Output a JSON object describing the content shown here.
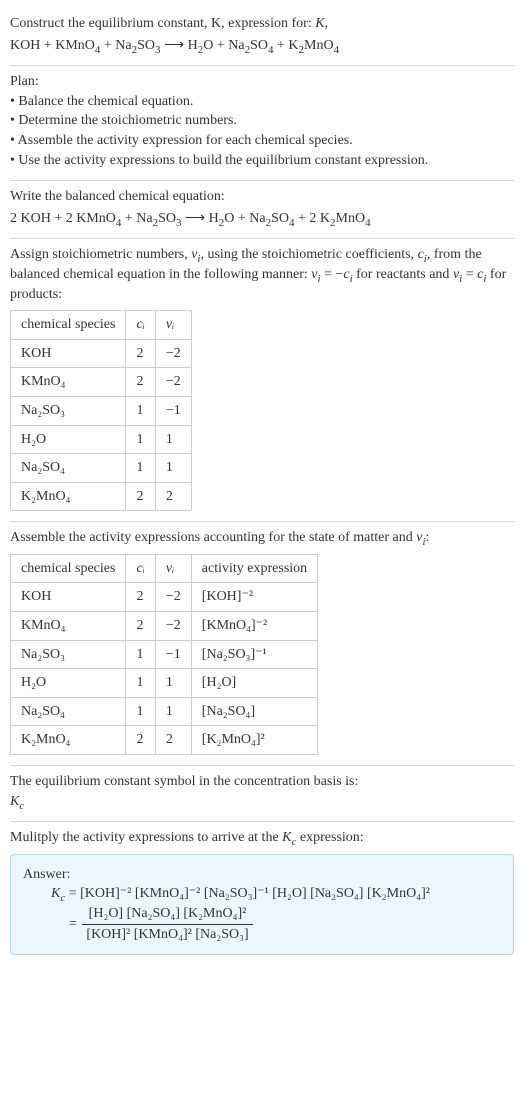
{
  "intro": {
    "line1": "Construct the equilibrium constant, K, expression for:",
    "eq_lhs": "KOH + KMnO",
    "eq_mid1": " + Na",
    "eq_mid2": "SO",
    "eq_arrow": " ⟶ H",
    "eq_mid3": "O + Na",
    "eq_mid4": "SO",
    "eq_mid5": " + K",
    "eq_mid6": "MnO"
  },
  "plan": {
    "head": "Plan:",
    "item1": "• Balance the chemical equation.",
    "item2": "• Determine the stoichiometric numbers.",
    "item3": "• Assemble the activity expression for each chemical species.",
    "item4": "• Use the activity expressions to build the equilibrium constant expression."
  },
  "balanced": {
    "head": "Write the balanced chemical equation:",
    "pre1": "2 KOH + 2 KMnO",
    "pre2": " + Na",
    "pre3": "SO",
    "arrow": " ⟶ H",
    "post1": "O + Na",
    "post2": "SO",
    "post3": " + 2 K",
    "post4": "MnO"
  },
  "stoich_text": {
    "line1_a": "Assign stoichiometric numbers, ",
    "line1_b": ", using the stoichiometric coefficients, ",
    "line1_c": ", from the balanced chemical equation in the following manner: ",
    "line1_d": " for reactants and ",
    "line1_e": " for products:",
    "nu": "ν",
    "c": "c",
    "sub": "i",
    "eq1": " = −",
    "eq2": " = "
  },
  "table1": {
    "h1": "chemical species",
    "h2": "cᵢ",
    "h3": "νᵢ",
    "rows": [
      {
        "sp": "KOH",
        "c": "2",
        "v": "−2"
      },
      {
        "sp": "KMnO₄",
        "c": "2",
        "v": "−2"
      },
      {
        "sp": "Na₂SO₃",
        "c": "1",
        "v": "−1"
      },
      {
        "sp": "H₂O",
        "c": "1",
        "v": "1"
      },
      {
        "sp": "Na₂SO₄",
        "c": "1",
        "v": "1"
      },
      {
        "sp": "K₂MnO₄",
        "c": "2",
        "v": "2"
      }
    ]
  },
  "assemble_text": {
    "a": "Assemble the activity expressions accounting for the state of matter and ",
    "b": ":"
  },
  "table2": {
    "h1": "chemical species",
    "h2": "cᵢ",
    "h3": "νᵢ",
    "h4": "activity expression",
    "rows": [
      {
        "sp": "KOH",
        "c": "2",
        "v": "−2",
        "ae": "[KOH]⁻²"
      },
      {
        "sp": "KMnO₄",
        "c": "2",
        "v": "−2",
        "ae": "[KMnO₄]⁻²"
      },
      {
        "sp": "Na₂SO₃",
        "c": "1",
        "v": "−1",
        "ae": "[Na₂SO₃]⁻¹"
      },
      {
        "sp": "H₂O",
        "c": "1",
        "v": "1",
        "ae": "[H₂O]"
      },
      {
        "sp": "Na₂SO₄",
        "c": "1",
        "v": "1",
        "ae": "[Na₂SO₄]"
      },
      {
        "sp": "K₂MnO₄",
        "c": "2",
        "v": "2",
        "ae": "[K₂MnO₄]²"
      }
    ]
  },
  "symbol": {
    "line": "The equilibrium constant symbol in the concentration basis is:",
    "kc": "K",
    "sub": "c"
  },
  "multiply": {
    "a": "Mulitply the activity expressions to arrive at the ",
    "b": " expression:"
  },
  "answer": {
    "head": "Answer:",
    "kc": "K",
    "sub": "c",
    "eq": " = ",
    "line1": "[KOH]⁻² [KMnO₄]⁻² [Na₂SO₃]⁻¹ [H₂O] [Na₂SO₄] [K₂MnO₄]²",
    "eq2": "= ",
    "num": "[H₂O] [Na₂SO₄] [K₂MnO₄]²",
    "den": "[KOH]² [KMnO₄]² [Na₂SO₃]"
  },
  "chart_data": {
    "type": "table",
    "tables": [
      {
        "title": "Stoichiometric numbers",
        "columns": [
          "chemical species",
          "c_i",
          "ν_i"
        ],
        "rows": [
          [
            "KOH",
            2,
            -2
          ],
          [
            "KMnO4",
            2,
            -2
          ],
          [
            "Na2SO3",
            1,
            -1
          ],
          [
            "H2O",
            1,
            1
          ],
          [
            "Na2SO4",
            1,
            1
          ],
          [
            "K2MnO4",
            2,
            2
          ]
        ]
      },
      {
        "title": "Activity expressions",
        "columns": [
          "chemical species",
          "c_i",
          "ν_i",
          "activity expression"
        ],
        "rows": [
          [
            "KOH",
            2,
            -2,
            "[KOH]^-2"
          ],
          [
            "KMnO4",
            2,
            -2,
            "[KMnO4]^-2"
          ],
          [
            "Na2SO3",
            1,
            -1,
            "[Na2SO3]^-1"
          ],
          [
            "H2O",
            1,
            1,
            "[H2O]"
          ],
          [
            "Na2SO4",
            1,
            1,
            "[Na2SO4]"
          ],
          [
            "K2MnO4",
            2,
            2,
            "[K2MnO4]^2"
          ]
        ]
      }
    ]
  }
}
